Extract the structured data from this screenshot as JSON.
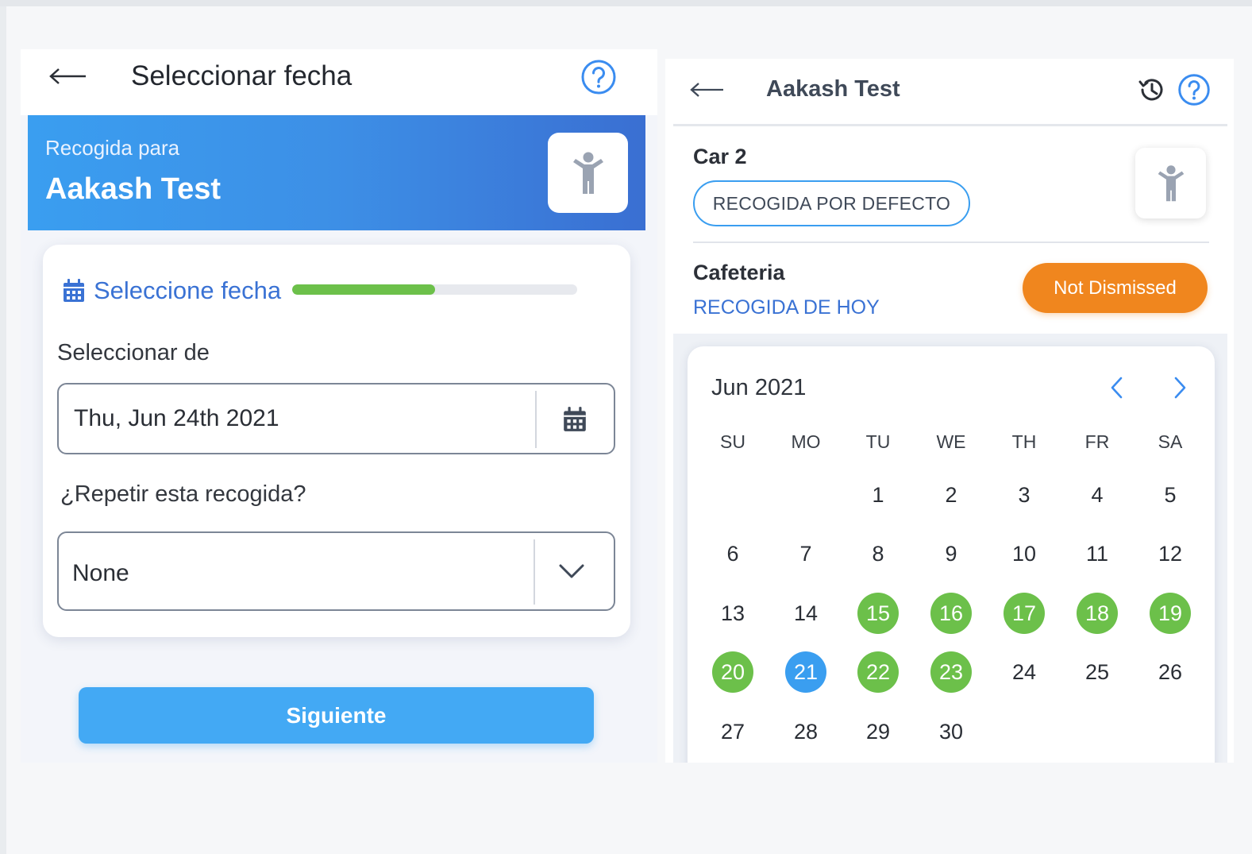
{
  "colors": {
    "banner_start": "#3a9ef0",
    "banner_end": "#3a6fd2",
    "accent_blue": "#3a72d4",
    "progress_green": "#6cc04a",
    "next_button": "#43a9f4",
    "status_orange": "#f0861e",
    "day_scheduled": "#6cc04a",
    "day_today": "#3a9ef0"
  },
  "left_panel": {
    "header": {
      "title": "Seleccionar fecha",
      "back_icon": "arrow-left-icon",
      "help_icon": "help-circle-icon"
    },
    "banner": {
      "label": "Recogida para",
      "student_name": "Aakash Test",
      "avatar_icon": "child-icon"
    },
    "form": {
      "step_label": "Seleccione fecha",
      "step_icon": "calendar-icon",
      "progress": 0.5,
      "date_field": {
        "label": "Seleccionar de",
        "value": "Thu, Jun 24th 2021",
        "icon": "calendar-icon"
      },
      "repeat_field": {
        "label": "¿Repetir esta recogida?",
        "value": "None",
        "icon": "chevron-down-icon"
      }
    },
    "next_button": "Siguiente"
  },
  "right_panel": {
    "header": {
      "title": "Aakash Test",
      "back_icon": "arrow-left-icon",
      "history_icon": "history-icon",
      "help_icon": "help-circle-icon"
    },
    "car": {
      "name": "Car 2",
      "default_pickup_button": "RECOGIDA POR DEFECTO",
      "avatar_icon": "child-icon"
    },
    "cafeteria": {
      "name": "Cafeteria",
      "today_pickup_link": "RECOGIDA DE HOY",
      "status": "Not Dismissed"
    },
    "calendar": {
      "month_label": "Jun 2021",
      "prev_icon": "chevron-left-icon",
      "next_icon": "chevron-right-icon",
      "weekdays": [
        "SU",
        "MO",
        "TU",
        "WE",
        "TH",
        "FR",
        "SA"
      ],
      "weeks": [
        [
          null,
          null,
          "1",
          "2",
          "3",
          "4",
          "5"
        ],
        [
          "6",
          "7",
          "8",
          "9",
          "10",
          "11",
          "12"
        ],
        [
          "13",
          "14",
          "15",
          "16",
          "17",
          "18",
          "19"
        ],
        [
          "20",
          "21",
          "22",
          "23",
          "24",
          "25",
          "26"
        ],
        [
          "27",
          "28",
          "29",
          "30",
          null,
          null,
          null
        ]
      ],
      "scheduled_days": [
        "15",
        "16",
        "17",
        "18",
        "19",
        "20",
        "22",
        "23"
      ],
      "today": "21"
    }
  }
}
